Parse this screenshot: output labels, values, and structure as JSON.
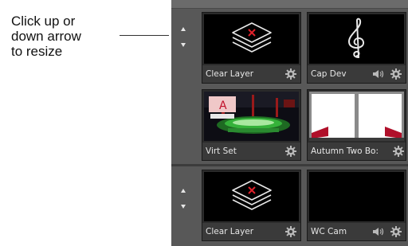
{
  "callout": {
    "line1": "Click up or",
    "line2": "down arrow",
    "line3": "to resize"
  },
  "tiles": [
    {
      "label": "Clear Layer",
      "thumbnail": "layers-x-icon"
    },
    {
      "label": "Cap Dev",
      "thumbnail": "treble-clef-icon"
    },
    {
      "label": "Virt Set",
      "thumbnail": "virtual-set-image",
      "badge": "A"
    },
    {
      "label": "Autumn Two Bo:",
      "thumbnail": "two-panel-image"
    },
    {
      "label": "Clear Layer",
      "thumbnail": "layers-x-icon"
    },
    {
      "label": "WC Cam",
      "thumbnail": "black"
    }
  ],
  "colors": {
    "panel": "#585858",
    "tile": "#2b2b2b",
    "label_bar": "#3a3a3a",
    "x_mark": "#e0202a",
    "accent_red": "#c0102a"
  }
}
